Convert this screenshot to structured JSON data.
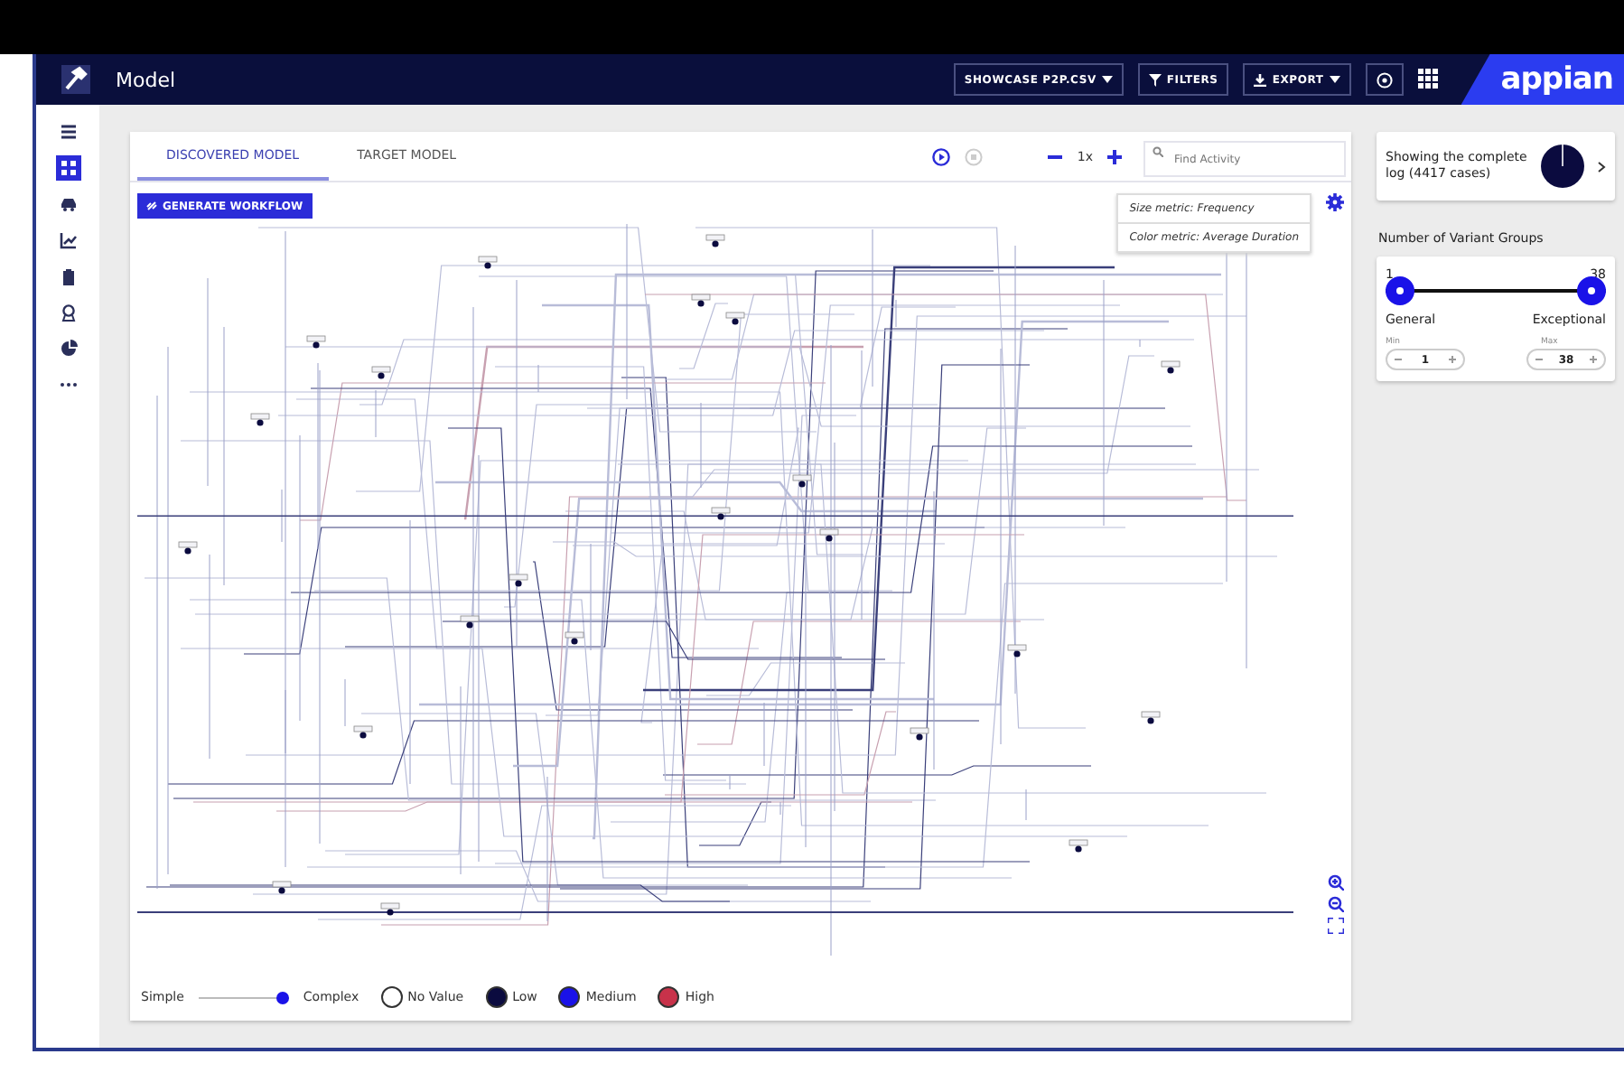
{
  "header": {
    "title": "Model",
    "dataset": "SHOWCASE P2P.CSV",
    "filters": "FILTERS",
    "export": "EXPORT",
    "logo": "appian"
  },
  "sidebar": {
    "items": [
      {
        "kind": "list",
        "selected": false
      },
      {
        "kind": "model",
        "selected": true
      },
      {
        "kind": "car",
        "selected": false
      },
      {
        "kind": "chart",
        "selected": false
      },
      {
        "kind": "clipboard",
        "selected": false
      },
      {
        "kind": "award",
        "selected": false
      },
      {
        "kind": "pie",
        "selected": false
      },
      {
        "kind": "more",
        "selected": false
      }
    ]
  },
  "tabs": [
    {
      "label": "DISCOVERED MODEL",
      "selected": true
    },
    {
      "label": "TARGET MODEL",
      "selected": false
    }
  ],
  "playback": {
    "speed": "1x"
  },
  "search": {
    "placeholder": "Find Activity"
  },
  "generate_button": "GENERATE WORKFLOW",
  "metrics": [
    "Size metric: Frequency",
    "Color metric: Average Duration"
  ],
  "complexity": {
    "left": "Simple",
    "right": "Complex",
    "level": 1
  },
  "legend": [
    {
      "label": "No Value",
      "color": "#ffffff"
    },
    {
      "label": "Low",
      "color": "#0b0b3f"
    },
    {
      "label": "Medium",
      "color": "#1a12e8"
    },
    {
      "label": "High",
      "color": "#c8324a"
    }
  ],
  "log_card": {
    "text": "Showing the complete log (4417 cases)"
  },
  "variants": {
    "title": "Number of Variant Groups",
    "thumbs": [
      {
        "value": "1",
        "label": "General",
        "level": 0,
        "field_label": "Min",
        "field_value": "1"
      },
      {
        "value": "38",
        "label": "Exceptional",
        "level": 1,
        "field_label": "Max",
        "field_value": "38"
      }
    ]
  }
}
